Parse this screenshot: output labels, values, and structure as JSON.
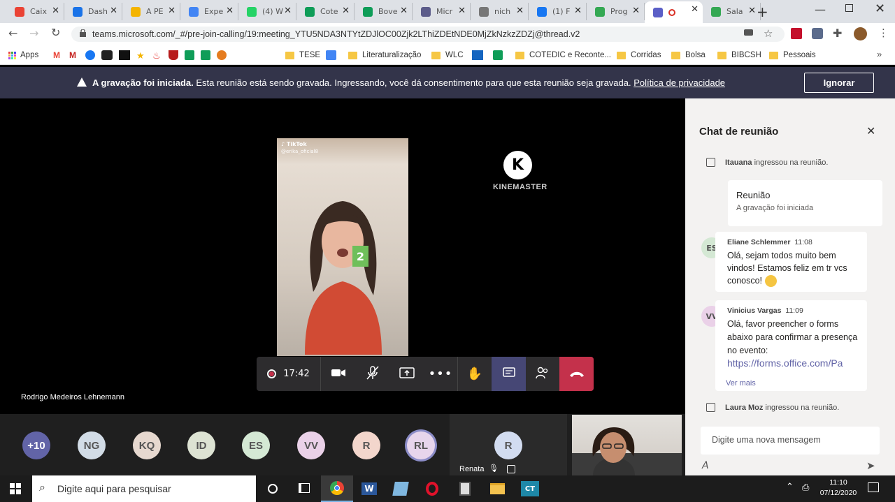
{
  "browser": {
    "tabs": [
      {
        "label": "Caix",
        "icon": "gmail-icon",
        "color": "#ea4335"
      },
      {
        "label": "Dash",
        "icon": "globe-icon",
        "color": "#1a73e8"
      },
      {
        "label": "A PE",
        "icon": "slides-icon",
        "color": "#f4b400"
      },
      {
        "label": "Expe",
        "icon": "docs-icon",
        "color": "#4285f4"
      },
      {
        "label": "(4) W",
        "icon": "whatsapp-icon",
        "color": "#25d366"
      },
      {
        "label": "Cote",
        "icon": "sheets-icon",
        "color": "#0f9d58"
      },
      {
        "label": "Bove",
        "icon": "sheets-icon",
        "color": "#0f9d58"
      },
      {
        "label": "Micr",
        "icon": "gear-icon",
        "color": "#5c5c8a"
      },
      {
        "label": "nich",
        "icon": "globe-icon",
        "color": "#777777"
      },
      {
        "label": "(1) F",
        "icon": "facebook-icon",
        "color": "#1877f2"
      },
      {
        "label": "Prog",
        "icon": "drive-icon",
        "color": "#34a853"
      },
      {
        "label": "",
        "icon": "teams-icon",
        "color": "#5b5fc7"
      },
      {
        "label": "Sala",
        "icon": "drive-icon",
        "color": "#34a853"
      }
    ],
    "url": "teams.microsoft.com/_#/pre-join-calling/19:meeting_YTU5NDA3NTYtZDJlOC00Zjk2LThiZDEtNDE0MjZkNzkzZDZj@thread.v2",
    "bookmarks": [
      "Apps",
      "TESE",
      "Literaturalização",
      "WLC",
      "COTEDIC e Reconte...",
      "Corridas",
      "Bolsa",
      "BIBCSH",
      "Pessoais"
    ]
  },
  "banner": {
    "title": "A gravação foi iniciada.",
    "text": "Esta reunião está sendo gravada. Ingressando, você dá consentimento para que esta reunião seja gravada.",
    "link": "Política de privacidade",
    "dismiss": "Ignorar"
  },
  "stage": {
    "video_watermark": "KINEMASTER",
    "tiktok_label": "TikTok",
    "tiktok_user": "@erika_oficial8",
    "overlay_number": "2",
    "presenter_name": "Rodrigo Medeiros Lehnemann"
  },
  "toolbar": {
    "timer": "17:42",
    "accent": "#c4314b"
  },
  "chat": {
    "title": "Chat de reunião",
    "events": [
      {
        "name": "Itauana",
        "text": "ingressou na reunião."
      },
      {
        "name": "Laura Moz",
        "text": "ingressou na reunião."
      }
    ],
    "meeting_card": {
      "title": "Reunião",
      "subtitle": "A gravação foi iniciada"
    },
    "messages": [
      {
        "initials": "ES",
        "author": "Eliane Schlemmer",
        "time": "11:08",
        "text": "Olá, sejam todos muito bem vindos! Estamos feliz em tr vcs conosco!",
        "avatar_color": "#d4e8d4"
      },
      {
        "initials": "VV",
        "author": "Vinicius Vargas",
        "time": "11:09",
        "text": "Olá, favor preencher o forms abaixo para confirmar a presença no evento:",
        "link": "https://forms.office.com/Pa",
        "more": "Ver mais",
        "avatar_color": "#ead1e8"
      }
    ],
    "input_placeholder": "Digite uma nova mensagem"
  },
  "participants": [
    {
      "initials": "+10",
      "color": "#6264a7",
      "text_color": "#ffffff"
    },
    {
      "initials": "NG",
      "color": "#d2dce6",
      "text_color": "#555555"
    },
    {
      "initials": "KQ",
      "color": "#e6d8cf",
      "text_color": "#555555"
    },
    {
      "initials": "ID",
      "color": "#dde3d3",
      "text_color": "#555555"
    },
    {
      "initials": "ES",
      "color": "#d4e8d4",
      "text_color": "#555555"
    },
    {
      "initials": "VV",
      "color": "#ead1e8",
      "text_color": "#555555"
    },
    {
      "initials": "R",
      "color": "#f3d6cc",
      "text_color": "#555555"
    },
    {
      "initials": "RL",
      "color": "#e7d5ec",
      "text_color": "#555555"
    }
  ],
  "renata_tile": {
    "initials": "R",
    "name": "Renata"
  },
  "taskbar": {
    "search_placeholder": "Digite aqui para pesquisar",
    "time": "11:10",
    "date": "07/12/2020"
  }
}
